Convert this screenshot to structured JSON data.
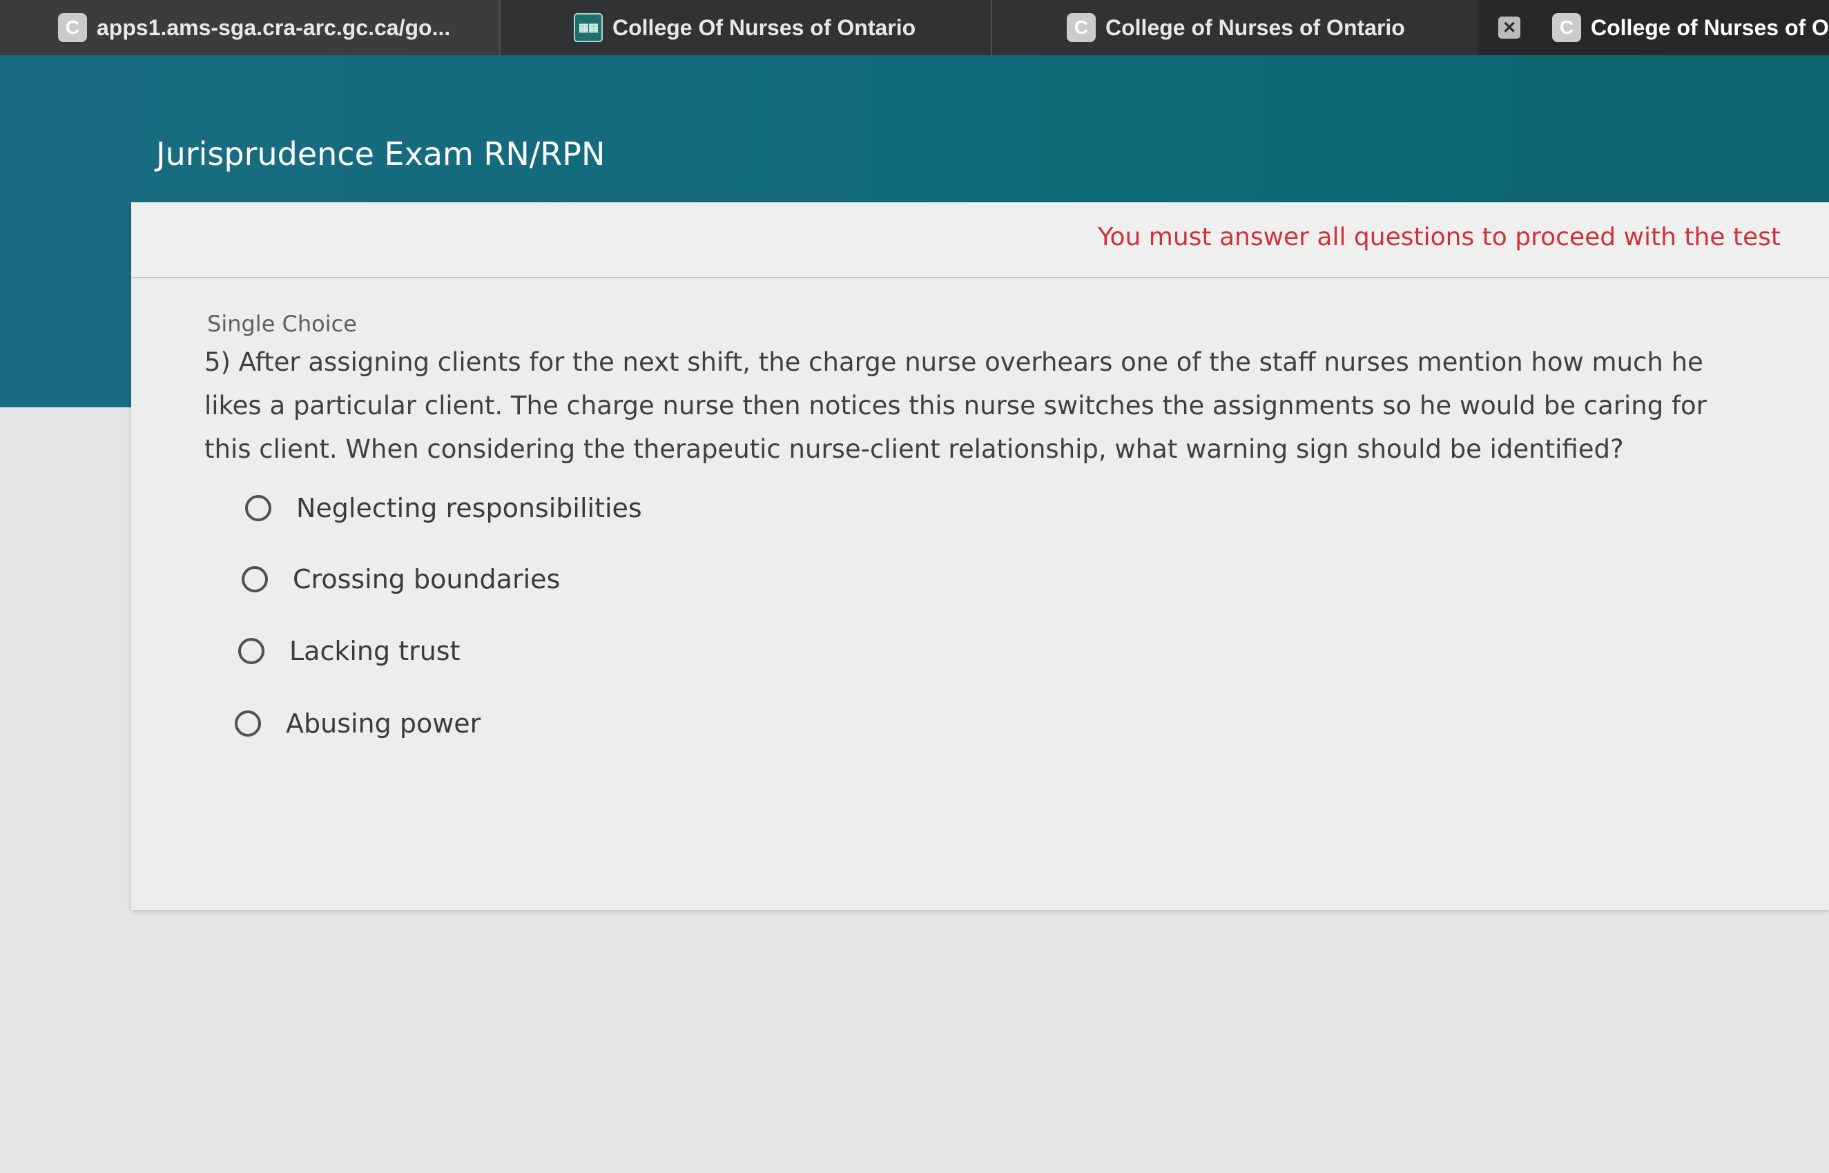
{
  "tabs": [
    {
      "label": "apps1.ams-sga.cra-arc.gc.ca/go...",
      "favicon": "C"
    },
    {
      "label": "College Of Nurses of Ontario",
      "favicon": "grid-icon"
    },
    {
      "label": "College of Nurses of Ontario",
      "favicon": "C"
    },
    {
      "label": "College of Nurses of Or",
      "favicon": "C"
    }
  ],
  "page": {
    "title": "Jurisprudence Exam RN/RPN"
  },
  "card": {
    "warning": "You must answer all questions to proceed with the test",
    "question_type": "Single Choice",
    "question": "5) After assigning clients for the next shift, the charge nurse overhears one of the staff nurses mention how much he likes a particular client. The charge nurse then notices this nurse switches the assignments so he would be caring for this client. When considering the therapeutic nurse-client relationship, what warning sign should be identified?",
    "options": [
      "Neglecting responsibilities",
      "Crossing boundaries",
      "Lacking trust",
      "Abusing power"
    ]
  },
  "colors": {
    "banner": "#0f6a78",
    "warning": "#d0313b",
    "card": "#ecedec"
  }
}
